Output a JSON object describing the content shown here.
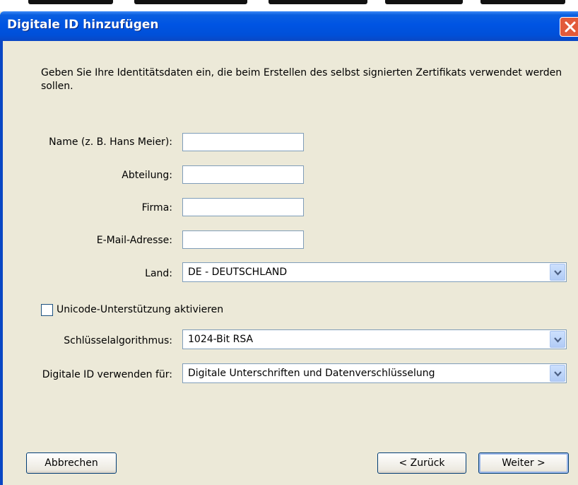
{
  "dialog": {
    "title": "Digitale ID hinzufügen",
    "intro": "Geben Sie Ihre Identitätsdaten ein, die beim Erstellen des selbst signierten Zertifikats verwendet werden sollen."
  },
  "form": {
    "name_label": "Name (z. B. Hans Meier):",
    "name_value": "",
    "department_label": "Abteilung:",
    "department_value": "",
    "company_label": "Firma:",
    "company_value": "",
    "email_label": "E-Mail-Adresse:",
    "email_value": "",
    "country_label": "Land:",
    "country_value": "DE - DEUTSCHLAND",
    "unicode_label": "Unicode-Unterstützung aktivieren",
    "unicode_checked": false,
    "key_algorithm_label": "Schlüsselalgorithmus:",
    "key_algorithm_value": "1024-Bit RSA",
    "usage_label": "Digitale ID verwenden für:",
    "usage_value": "Digitale Unterschriften und Datenverschlüsselung"
  },
  "buttons": {
    "cancel": "Abbrechen",
    "back": "< Zurück",
    "next": "Weiter >"
  },
  "colors": {
    "titlebar": "#0054e3",
    "dialog_bg": "#ece9d8",
    "close": "#e25a3a",
    "field_border": "#7f9db9"
  }
}
